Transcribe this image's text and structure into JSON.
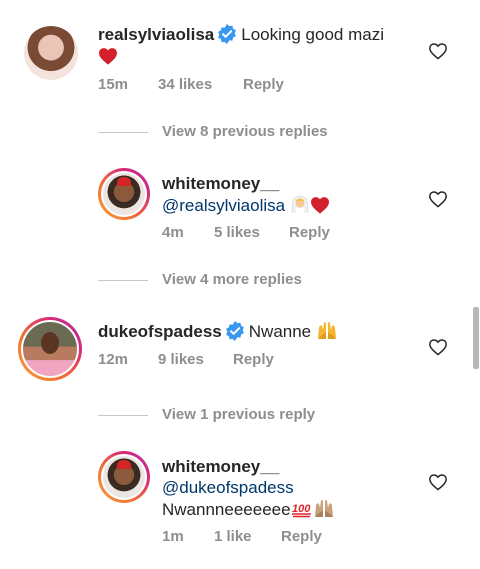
{
  "comments": [
    {
      "username": "realsylviaolisa",
      "verified": true,
      "text": "Looking good mazi",
      "emoji_line2": "red-heart",
      "time": "15m",
      "likes": "34 likes",
      "reply": "Reply"
    },
    {
      "view_replies": "View 8 previous replies"
    },
    {
      "username": "whitemoney__",
      "mention": "@realsylviaolisa",
      "emojis": [
        "woman-with-veil",
        "red-heart"
      ],
      "time": "4m",
      "likes": "5 likes",
      "reply": "Reply"
    },
    {
      "view_replies": "View 4 more replies"
    },
    {
      "username": "dukeofspadess",
      "verified": true,
      "text": "Nwanne",
      "emoji": "raising-hands",
      "time": "12m",
      "likes": "9 likes",
      "reply": "Reply"
    },
    {
      "view_replies": "View 1 previous reply"
    },
    {
      "username": "whitemoney__",
      "mention": "@dukeofspadess",
      "text": "Nwannneeeeeee",
      "emojis": [
        "hundred-points",
        "raising-hands"
      ],
      "time": "1m",
      "likes": "1 like",
      "reply": "Reply"
    }
  ],
  "colors": {
    "username": "#262626",
    "mention": "#00376b",
    "meta": "#8e8e8e",
    "verified": "#3897f0",
    "heart": "#e0245e"
  }
}
